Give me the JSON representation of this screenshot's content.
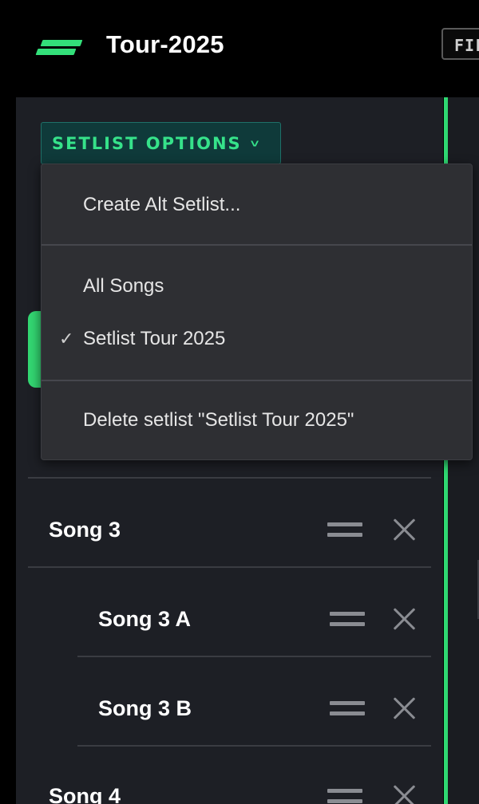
{
  "header": {
    "project_title": "Tour-2025",
    "file_button_label": "FILE"
  },
  "setlist_options": {
    "label": "SETLIST OPTIONS",
    "chevron_icon": "chevron-down-icon",
    "menu": {
      "create_alt": "Create Alt Setlist...",
      "all_songs": "All Songs",
      "selected_setlist": "Setlist Tour 2025",
      "check_mark": "✓",
      "delete": "Delete setlist \"Setlist Tour 2025\""
    }
  },
  "songs": [
    {
      "label": "Song 3"
    },
    {
      "label": "Song 3 A"
    },
    {
      "label": "Song 3 B"
    },
    {
      "label": "Song 4"
    }
  ],
  "icons": {
    "drag_handle": "drag-handle-icon",
    "remove": "close-icon",
    "logo": "logo-icon"
  },
  "colors": {
    "accent_green": "#33e07a",
    "panel_bg": "#1d1f25",
    "menu_bg": "#2e2f33",
    "button_bg": "#0f3a3a"
  }
}
